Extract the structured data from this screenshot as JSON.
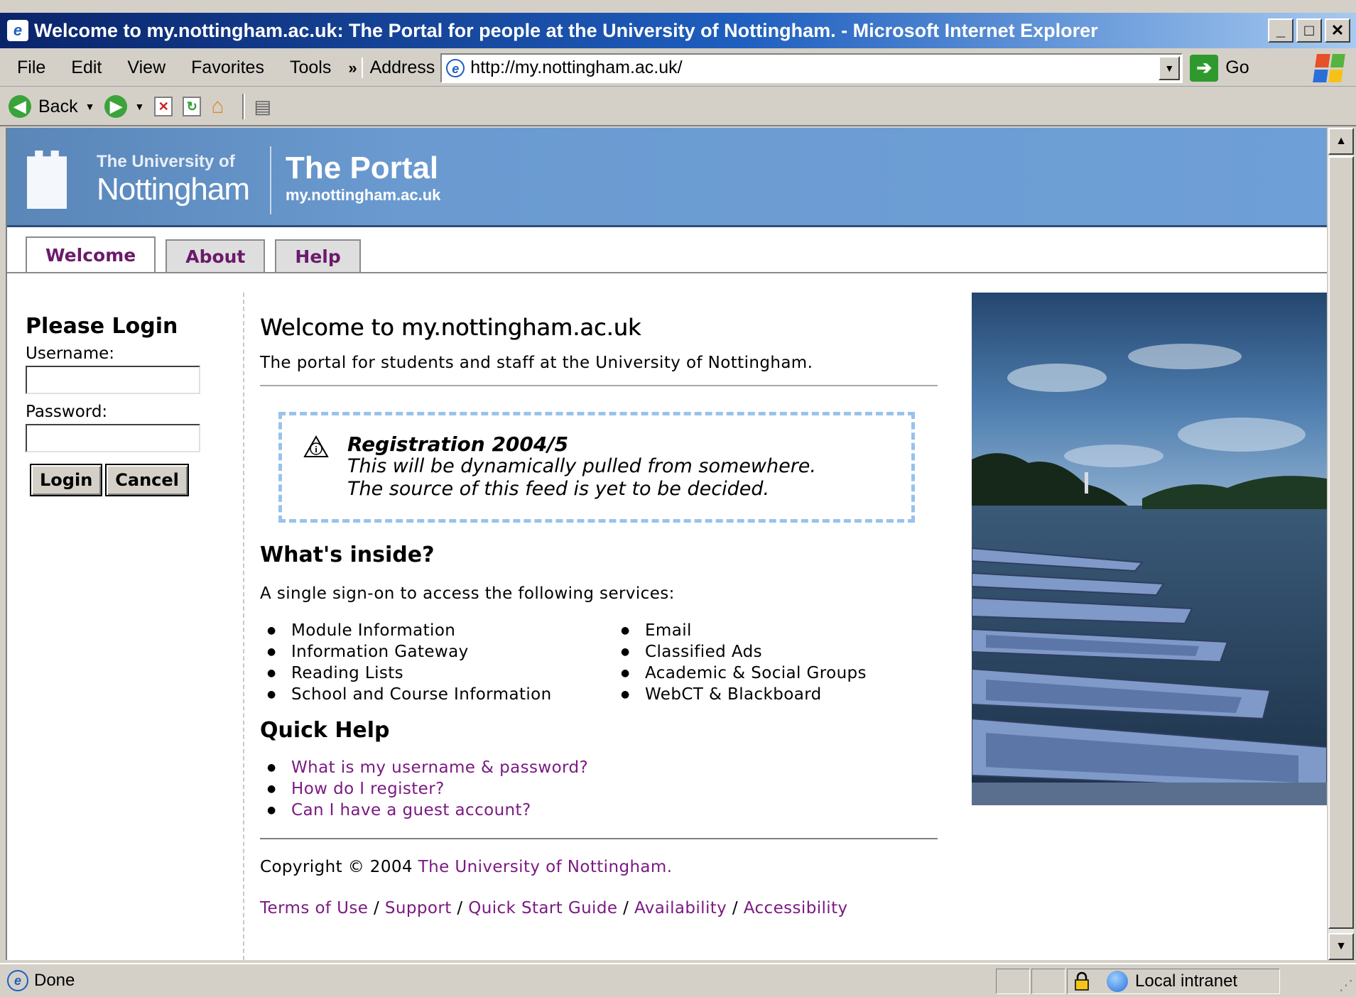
{
  "window": {
    "title": "Welcome to my.nottingham.ac.uk: The Portal for people at the University of Nottingham. - Microsoft Internet Explorer",
    "minimize_icon": "minimize-icon",
    "maximize_icon": "maximize-icon",
    "close_icon": "close-icon"
  },
  "menubar": {
    "items": [
      "File",
      "Edit",
      "View",
      "Favorites",
      "Tools"
    ],
    "overflow": "»",
    "address_label": "Address",
    "url": "http://my.nottingham.ac.uk/",
    "go_label": "Go"
  },
  "toolbar": {
    "back_label": "Back"
  },
  "banner": {
    "uni_small": "The University of",
    "uni_big": "Nottingham",
    "portal_title": "The Portal",
    "portal_url": "my.nottingham.ac.uk"
  },
  "tabs": [
    "Welcome",
    "About",
    "Help"
  ],
  "login": {
    "title": "Please Login",
    "username_label": "Username:",
    "username_value": "",
    "password_label": "Password:",
    "password_value": "",
    "login_button": "Login",
    "cancel_button": "Cancel"
  },
  "main": {
    "heading": "Welcome to my.nottingham.ac.uk",
    "intro": "The portal for students and staff at the University of Nottingham.",
    "notice": {
      "title": "Registration 2004/5",
      "line1": "This will be dynamically pulled from somewhere.",
      "line2": "The source of this feed is yet to be decided."
    },
    "inside_heading": "What's inside?",
    "inside_desc": "A single sign-on to access the following services:",
    "services_col1": [
      "Module Information",
      "Information Gateway",
      "Reading Lists",
      "School and Course Information"
    ],
    "services_col2": [
      "Email",
      "Classified Ads",
      "Academic & Social Groups",
      "WebCT & Blackboard"
    ],
    "quick_help_heading": "Quick Help",
    "quick_help_links": [
      "What is my username & password?",
      "How do I register?",
      "Can I have a guest account?"
    ],
    "copyright_prefix": "Copyright © 2004",
    "copyright_link": "The University of Nottingham.",
    "footer_links": [
      "Terms of Use",
      "Support",
      "Quick Start Guide",
      "Availability",
      "Accessibility"
    ],
    "footer_sep": "/"
  },
  "status": {
    "text": "Done",
    "zone": "Local intranet"
  },
  "colors": {
    "link": "#7b1a83",
    "banner": "#6a9ad0",
    "notice_border": "#99c2ec"
  }
}
